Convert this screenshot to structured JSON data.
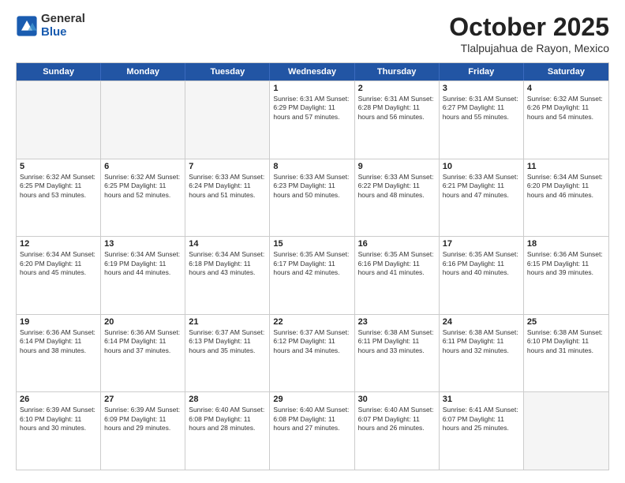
{
  "header": {
    "logo": {
      "general": "General",
      "blue": "Blue"
    },
    "month": "October 2025",
    "location": "Tlalpujahua de Rayon, Mexico"
  },
  "weekdays": [
    "Sunday",
    "Monday",
    "Tuesday",
    "Wednesday",
    "Thursday",
    "Friday",
    "Saturday"
  ],
  "weeks": [
    [
      {
        "day": "",
        "info": "",
        "empty": true
      },
      {
        "day": "",
        "info": "",
        "empty": true
      },
      {
        "day": "",
        "info": "",
        "empty": true
      },
      {
        "day": "1",
        "info": "Sunrise: 6:31 AM\nSunset: 6:29 PM\nDaylight: 11 hours\nand 57 minutes.",
        "empty": false
      },
      {
        "day": "2",
        "info": "Sunrise: 6:31 AM\nSunset: 6:28 PM\nDaylight: 11 hours\nand 56 minutes.",
        "empty": false
      },
      {
        "day": "3",
        "info": "Sunrise: 6:31 AM\nSunset: 6:27 PM\nDaylight: 11 hours\nand 55 minutes.",
        "empty": false
      },
      {
        "day": "4",
        "info": "Sunrise: 6:32 AM\nSunset: 6:26 PM\nDaylight: 11 hours\nand 54 minutes.",
        "empty": false
      }
    ],
    [
      {
        "day": "5",
        "info": "Sunrise: 6:32 AM\nSunset: 6:25 PM\nDaylight: 11 hours\nand 53 minutes.",
        "empty": false
      },
      {
        "day": "6",
        "info": "Sunrise: 6:32 AM\nSunset: 6:25 PM\nDaylight: 11 hours\nand 52 minutes.",
        "empty": false
      },
      {
        "day": "7",
        "info": "Sunrise: 6:33 AM\nSunset: 6:24 PM\nDaylight: 11 hours\nand 51 minutes.",
        "empty": false
      },
      {
        "day": "8",
        "info": "Sunrise: 6:33 AM\nSunset: 6:23 PM\nDaylight: 11 hours\nand 50 minutes.",
        "empty": false
      },
      {
        "day": "9",
        "info": "Sunrise: 6:33 AM\nSunset: 6:22 PM\nDaylight: 11 hours\nand 48 minutes.",
        "empty": false
      },
      {
        "day": "10",
        "info": "Sunrise: 6:33 AM\nSunset: 6:21 PM\nDaylight: 11 hours\nand 47 minutes.",
        "empty": false
      },
      {
        "day": "11",
        "info": "Sunrise: 6:34 AM\nSunset: 6:20 PM\nDaylight: 11 hours\nand 46 minutes.",
        "empty": false
      }
    ],
    [
      {
        "day": "12",
        "info": "Sunrise: 6:34 AM\nSunset: 6:20 PM\nDaylight: 11 hours\nand 45 minutes.",
        "empty": false
      },
      {
        "day": "13",
        "info": "Sunrise: 6:34 AM\nSunset: 6:19 PM\nDaylight: 11 hours\nand 44 minutes.",
        "empty": false
      },
      {
        "day": "14",
        "info": "Sunrise: 6:34 AM\nSunset: 6:18 PM\nDaylight: 11 hours\nand 43 minutes.",
        "empty": false
      },
      {
        "day": "15",
        "info": "Sunrise: 6:35 AM\nSunset: 6:17 PM\nDaylight: 11 hours\nand 42 minutes.",
        "empty": false
      },
      {
        "day": "16",
        "info": "Sunrise: 6:35 AM\nSunset: 6:16 PM\nDaylight: 11 hours\nand 41 minutes.",
        "empty": false
      },
      {
        "day": "17",
        "info": "Sunrise: 6:35 AM\nSunset: 6:16 PM\nDaylight: 11 hours\nand 40 minutes.",
        "empty": false
      },
      {
        "day": "18",
        "info": "Sunrise: 6:36 AM\nSunset: 6:15 PM\nDaylight: 11 hours\nand 39 minutes.",
        "empty": false
      }
    ],
    [
      {
        "day": "19",
        "info": "Sunrise: 6:36 AM\nSunset: 6:14 PM\nDaylight: 11 hours\nand 38 minutes.",
        "empty": false
      },
      {
        "day": "20",
        "info": "Sunrise: 6:36 AM\nSunset: 6:14 PM\nDaylight: 11 hours\nand 37 minutes.",
        "empty": false
      },
      {
        "day": "21",
        "info": "Sunrise: 6:37 AM\nSunset: 6:13 PM\nDaylight: 11 hours\nand 35 minutes.",
        "empty": false
      },
      {
        "day": "22",
        "info": "Sunrise: 6:37 AM\nSunset: 6:12 PM\nDaylight: 11 hours\nand 34 minutes.",
        "empty": false
      },
      {
        "day": "23",
        "info": "Sunrise: 6:38 AM\nSunset: 6:11 PM\nDaylight: 11 hours\nand 33 minutes.",
        "empty": false
      },
      {
        "day": "24",
        "info": "Sunrise: 6:38 AM\nSunset: 6:11 PM\nDaylight: 11 hours\nand 32 minutes.",
        "empty": false
      },
      {
        "day": "25",
        "info": "Sunrise: 6:38 AM\nSunset: 6:10 PM\nDaylight: 11 hours\nand 31 minutes.",
        "empty": false
      }
    ],
    [
      {
        "day": "26",
        "info": "Sunrise: 6:39 AM\nSunset: 6:10 PM\nDaylight: 11 hours\nand 30 minutes.",
        "empty": false
      },
      {
        "day": "27",
        "info": "Sunrise: 6:39 AM\nSunset: 6:09 PM\nDaylight: 11 hours\nand 29 minutes.",
        "empty": false
      },
      {
        "day": "28",
        "info": "Sunrise: 6:40 AM\nSunset: 6:08 PM\nDaylight: 11 hours\nand 28 minutes.",
        "empty": false
      },
      {
        "day": "29",
        "info": "Sunrise: 6:40 AM\nSunset: 6:08 PM\nDaylight: 11 hours\nand 27 minutes.",
        "empty": false
      },
      {
        "day": "30",
        "info": "Sunrise: 6:40 AM\nSunset: 6:07 PM\nDaylight: 11 hours\nand 26 minutes.",
        "empty": false
      },
      {
        "day": "31",
        "info": "Sunrise: 6:41 AM\nSunset: 6:07 PM\nDaylight: 11 hours\nand 25 minutes.",
        "empty": false
      },
      {
        "day": "",
        "info": "",
        "empty": true
      }
    ]
  ]
}
